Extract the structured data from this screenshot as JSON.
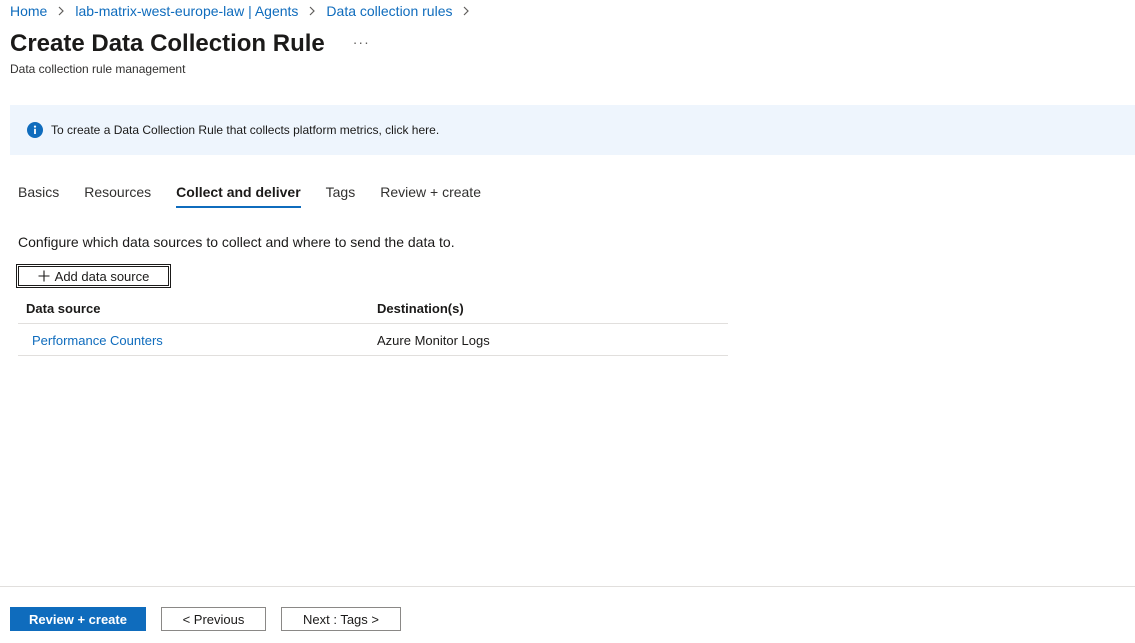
{
  "breadcrumb": {
    "items": [
      "Home",
      "lab-matrix-west-europe-law | Agents",
      "Data collection rules"
    ]
  },
  "header": {
    "title": "Create Data Collection Rule",
    "more_label": "···",
    "subtitle": "Data collection rule management"
  },
  "banner": {
    "icon": "info-icon",
    "text": "To create a Data Collection Rule that collects platform metrics, click here."
  },
  "tabs": [
    {
      "label": "Basics",
      "active": false
    },
    {
      "label": "Resources",
      "active": false
    },
    {
      "label": "Collect and deliver",
      "active": true
    },
    {
      "label": "Tags",
      "active": false
    },
    {
      "label": "Review + create",
      "active": false
    }
  ],
  "content": {
    "description": "Configure which data sources to collect and where to send the data to.",
    "add_button_label": "Add data source"
  },
  "table": {
    "columns": [
      "Data source",
      "Destination(s)"
    ],
    "rows": [
      {
        "data_source": "Performance Counters",
        "destinations": "Azure Monitor Logs"
      }
    ]
  },
  "footer": {
    "review_create_label": "Review + create",
    "previous_label": "< Previous",
    "next_label": "Next : Tags >"
  },
  "colors": {
    "accent": "#0f6cbd",
    "banner_bg": "#eef5fd"
  }
}
